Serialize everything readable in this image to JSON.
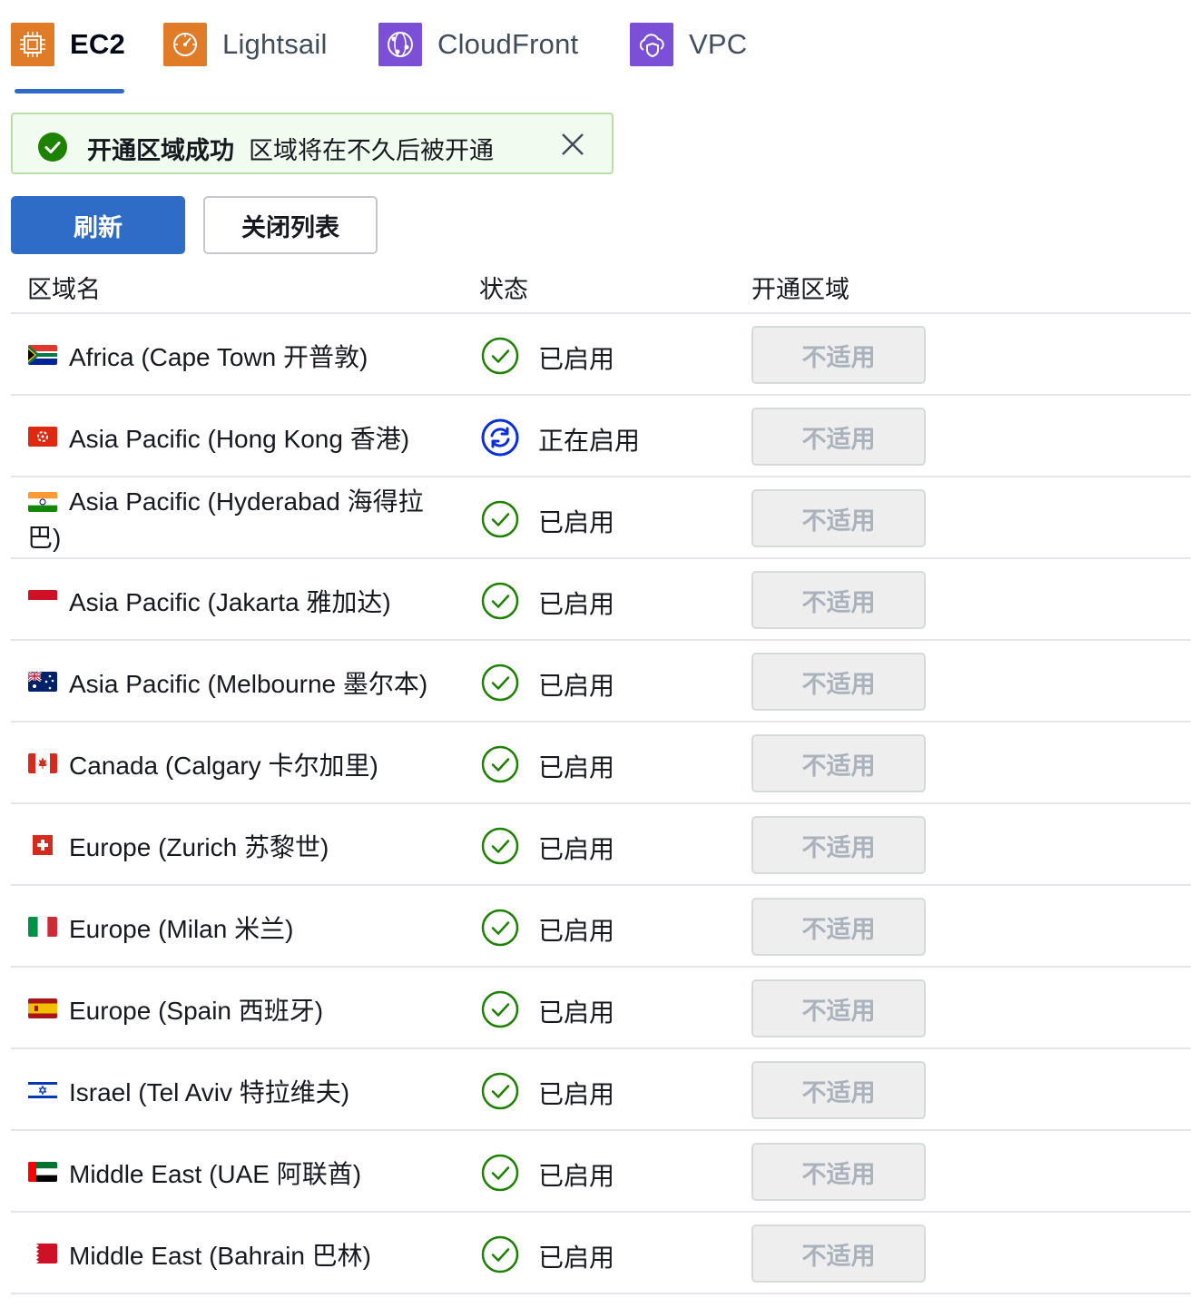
{
  "tabs": [
    {
      "label": "EC2",
      "icon": "ec2-icon",
      "color": "#e07b28",
      "active": true
    },
    {
      "label": "Lightsail",
      "icon": "lightsail-icon",
      "color": "#e07b28",
      "active": false
    },
    {
      "label": "CloudFront",
      "icon": "cloudfront-icon",
      "color": "#7b4fd6",
      "active": false
    },
    {
      "label": "VPC",
      "icon": "vpc-icon",
      "color": "#7b4fd6",
      "active": false
    }
  ],
  "flash": {
    "title": "开通区域成功",
    "message": "区域将在不久后被开通"
  },
  "buttons": {
    "refresh": "刷新",
    "close_list": "关闭列表"
  },
  "table": {
    "headers": {
      "name": "区域名",
      "status": "状态",
      "enable": "开通区域"
    },
    "rows": [
      {
        "name": "Africa (Cape Town 开普敦)",
        "flag": "south-africa-flag",
        "status": "已启用",
        "state": "enabled",
        "action": "不适用"
      },
      {
        "name": "Asia Pacific (Hong Kong 香港)",
        "flag": "hong-kong-flag",
        "status": "正在启用",
        "state": "enabling",
        "action": "不适用"
      },
      {
        "name": "Asia Pacific (Hyderabad 海得拉巴)",
        "flag": "india-flag",
        "status": "已启用",
        "state": "enabled",
        "action": "不适用"
      },
      {
        "name": "Asia Pacific (Jakarta 雅加达)",
        "flag": "indonesia-flag",
        "status": "已启用",
        "state": "enabled",
        "action": "不适用"
      },
      {
        "name": "Asia Pacific (Melbourne 墨尔本)",
        "flag": "australia-flag",
        "status": "已启用",
        "state": "enabled",
        "action": "不适用"
      },
      {
        "name": "Canada (Calgary 卡尔加里)",
        "flag": "canada-flag",
        "status": "已启用",
        "state": "enabled",
        "action": "不适用"
      },
      {
        "name": "Europe (Zurich 苏黎世)",
        "flag": "switzerland-flag",
        "status": "已启用",
        "state": "enabled",
        "action": "不适用"
      },
      {
        "name": "Europe (Milan 米兰)",
        "flag": "italy-flag",
        "status": "已启用",
        "state": "enabled",
        "action": "不适用"
      },
      {
        "name": "Europe (Spain 西班牙)",
        "flag": "spain-flag",
        "status": "已启用",
        "state": "enabled",
        "action": "不适用"
      },
      {
        "name": "Israel (Tel Aviv 特拉维夫)",
        "flag": "israel-flag",
        "status": "已启用",
        "state": "enabled",
        "action": "不适用"
      },
      {
        "name": "Middle East (UAE 阿联酋)",
        "flag": "uae-flag",
        "status": "已启用",
        "state": "enabled",
        "action": "不适用"
      },
      {
        "name": "Middle East (Bahrain 巴林)",
        "flag": "bahrain-flag",
        "status": "已启用",
        "state": "enabled",
        "action": "不适用"
      }
    ]
  },
  "colors": {
    "primary": "#2e6cc8",
    "success": "#1d8102",
    "enabling": "#0a2ed9",
    "disabled_bg": "#eeeeee",
    "disabled_text": "#aab2bd"
  }
}
